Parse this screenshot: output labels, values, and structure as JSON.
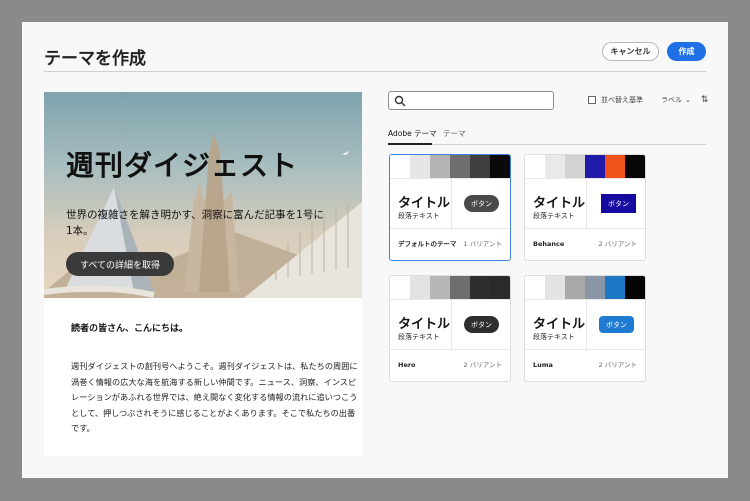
{
  "dialog": {
    "title": "テーマを作成",
    "cancel_label": "キャンセル",
    "create_label": "作成"
  },
  "preview": {
    "hero_title": "週刊ダイジェスト",
    "hero_subtitle": "世界の複雑さを解き明かす、洞察に富んだ記事を1号に1本。",
    "hero_button": "すべての詳細を取得",
    "greeting": "読者の皆さん、こんにちは。",
    "body": "週刊ダイジェストの創刊号へようこそ。週刊ダイジェストは、私たちの周囲に渦巻く情報の広大な海を航海する新しい仲間です。ニュース、洞察、インスピレーションがあふれる世界では、絶え間なく変化する情報の流れに追いつこうとして、押しつぶされそうに感じることがよくあります。そこで私たちの出番です。"
  },
  "toolbar": {
    "search_placeholder": "",
    "sort_label": "並べ替え基準",
    "sort_value": "ラベル"
  },
  "tabs": [
    {
      "label": "Adobe テーマ"
    },
    {
      "label": "テーマ"
    }
  ],
  "themes": [
    {
      "name": "デフォルトのテーマ",
      "variants": "1 バリアント",
      "heading": "タイトル",
      "paragraph": "段落テキスト",
      "button": "ボタン",
      "swatches": [
        "#ffffff",
        "#e6e6e6",
        "#b4b4b4",
        "#6e6e6e",
        "#3e3e3e",
        "#0a0a0a"
      ],
      "button_bg": "#4a4a4a",
      "button_fg": "#ffffff",
      "button_radius": "round"
    },
    {
      "name": "Behance",
      "variants": "2 バリアント",
      "heading": "タイトル",
      "paragraph": "段落テキスト",
      "button": "ボタン",
      "swatches": [
        "#ffffff",
        "#e9e9e9",
        "#d2d2d2",
        "#1f1aa8",
        "#f2531c",
        "#070707"
      ],
      "button_bg": "#160aa0",
      "button_fg": "#ffffff",
      "button_radius": "square"
    },
    {
      "name": "Hero",
      "variants": "2 バリアント",
      "heading": "タイトル",
      "paragraph": "段落テキスト",
      "button": "ボタン",
      "swatches": [
        "#ffffff",
        "#e2e2e2",
        "#b7b7b7",
        "#6e6e6e",
        "#2e2e2e",
        "#2a2a2a"
      ],
      "button_bg": "#2e2e2e",
      "button_fg": "#ffffff",
      "button_radius": "round"
    },
    {
      "name": "Luma",
      "variants": "2 バリアント",
      "heading": "タイトル",
      "paragraph": "段落テキスト",
      "button": "ボタン",
      "swatches": [
        "#ffffff",
        "#e3e3e3",
        "#a8a8a8",
        "#8a95a6",
        "#1c78c4",
        "#050505"
      ],
      "button_bg": "#1f7bd1",
      "button_fg": "#ffffff",
      "button_radius": "medium"
    }
  ]
}
